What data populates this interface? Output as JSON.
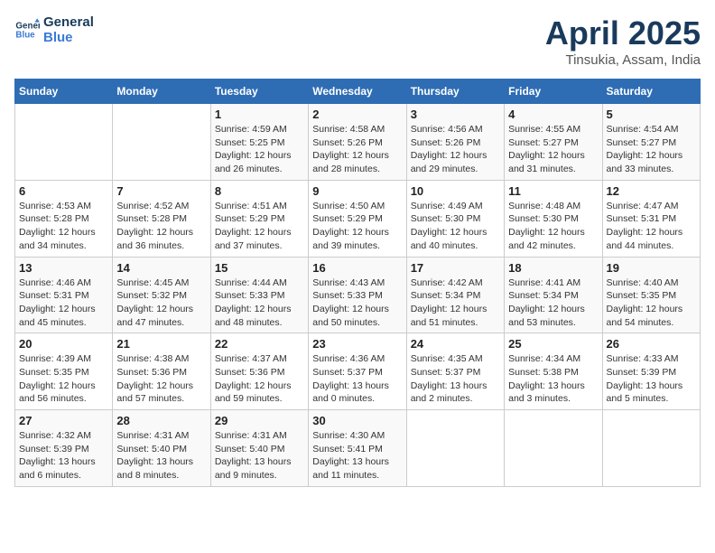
{
  "logo": {
    "line1": "General",
    "line2": "Blue"
  },
  "title": "April 2025",
  "subtitle": "Tinsukia, Assam, India",
  "weekdays": [
    "Sunday",
    "Monday",
    "Tuesday",
    "Wednesday",
    "Thursday",
    "Friday",
    "Saturday"
  ],
  "weeks": [
    [
      {
        "day": "",
        "info": ""
      },
      {
        "day": "",
        "info": ""
      },
      {
        "day": "1",
        "info": "Sunrise: 4:59 AM\nSunset: 5:25 PM\nDaylight: 12 hours and 26 minutes."
      },
      {
        "day": "2",
        "info": "Sunrise: 4:58 AM\nSunset: 5:26 PM\nDaylight: 12 hours and 28 minutes."
      },
      {
        "day": "3",
        "info": "Sunrise: 4:56 AM\nSunset: 5:26 PM\nDaylight: 12 hours and 29 minutes."
      },
      {
        "day": "4",
        "info": "Sunrise: 4:55 AM\nSunset: 5:27 PM\nDaylight: 12 hours and 31 minutes."
      },
      {
        "day": "5",
        "info": "Sunrise: 4:54 AM\nSunset: 5:27 PM\nDaylight: 12 hours and 33 minutes."
      }
    ],
    [
      {
        "day": "6",
        "info": "Sunrise: 4:53 AM\nSunset: 5:28 PM\nDaylight: 12 hours and 34 minutes."
      },
      {
        "day": "7",
        "info": "Sunrise: 4:52 AM\nSunset: 5:28 PM\nDaylight: 12 hours and 36 minutes."
      },
      {
        "day": "8",
        "info": "Sunrise: 4:51 AM\nSunset: 5:29 PM\nDaylight: 12 hours and 37 minutes."
      },
      {
        "day": "9",
        "info": "Sunrise: 4:50 AM\nSunset: 5:29 PM\nDaylight: 12 hours and 39 minutes."
      },
      {
        "day": "10",
        "info": "Sunrise: 4:49 AM\nSunset: 5:30 PM\nDaylight: 12 hours and 40 minutes."
      },
      {
        "day": "11",
        "info": "Sunrise: 4:48 AM\nSunset: 5:30 PM\nDaylight: 12 hours and 42 minutes."
      },
      {
        "day": "12",
        "info": "Sunrise: 4:47 AM\nSunset: 5:31 PM\nDaylight: 12 hours and 44 minutes."
      }
    ],
    [
      {
        "day": "13",
        "info": "Sunrise: 4:46 AM\nSunset: 5:31 PM\nDaylight: 12 hours and 45 minutes."
      },
      {
        "day": "14",
        "info": "Sunrise: 4:45 AM\nSunset: 5:32 PM\nDaylight: 12 hours and 47 minutes."
      },
      {
        "day": "15",
        "info": "Sunrise: 4:44 AM\nSunset: 5:33 PM\nDaylight: 12 hours and 48 minutes."
      },
      {
        "day": "16",
        "info": "Sunrise: 4:43 AM\nSunset: 5:33 PM\nDaylight: 12 hours and 50 minutes."
      },
      {
        "day": "17",
        "info": "Sunrise: 4:42 AM\nSunset: 5:34 PM\nDaylight: 12 hours and 51 minutes."
      },
      {
        "day": "18",
        "info": "Sunrise: 4:41 AM\nSunset: 5:34 PM\nDaylight: 12 hours and 53 minutes."
      },
      {
        "day": "19",
        "info": "Sunrise: 4:40 AM\nSunset: 5:35 PM\nDaylight: 12 hours and 54 minutes."
      }
    ],
    [
      {
        "day": "20",
        "info": "Sunrise: 4:39 AM\nSunset: 5:35 PM\nDaylight: 12 hours and 56 minutes."
      },
      {
        "day": "21",
        "info": "Sunrise: 4:38 AM\nSunset: 5:36 PM\nDaylight: 12 hours and 57 minutes."
      },
      {
        "day": "22",
        "info": "Sunrise: 4:37 AM\nSunset: 5:36 PM\nDaylight: 12 hours and 59 minutes."
      },
      {
        "day": "23",
        "info": "Sunrise: 4:36 AM\nSunset: 5:37 PM\nDaylight: 13 hours and 0 minutes."
      },
      {
        "day": "24",
        "info": "Sunrise: 4:35 AM\nSunset: 5:37 PM\nDaylight: 13 hours and 2 minutes."
      },
      {
        "day": "25",
        "info": "Sunrise: 4:34 AM\nSunset: 5:38 PM\nDaylight: 13 hours and 3 minutes."
      },
      {
        "day": "26",
        "info": "Sunrise: 4:33 AM\nSunset: 5:39 PM\nDaylight: 13 hours and 5 minutes."
      }
    ],
    [
      {
        "day": "27",
        "info": "Sunrise: 4:32 AM\nSunset: 5:39 PM\nDaylight: 13 hours and 6 minutes."
      },
      {
        "day": "28",
        "info": "Sunrise: 4:31 AM\nSunset: 5:40 PM\nDaylight: 13 hours and 8 minutes."
      },
      {
        "day": "29",
        "info": "Sunrise: 4:31 AM\nSunset: 5:40 PM\nDaylight: 13 hours and 9 minutes."
      },
      {
        "day": "30",
        "info": "Sunrise: 4:30 AM\nSunset: 5:41 PM\nDaylight: 13 hours and 11 minutes."
      },
      {
        "day": "",
        "info": ""
      },
      {
        "day": "",
        "info": ""
      },
      {
        "day": "",
        "info": ""
      }
    ]
  ]
}
